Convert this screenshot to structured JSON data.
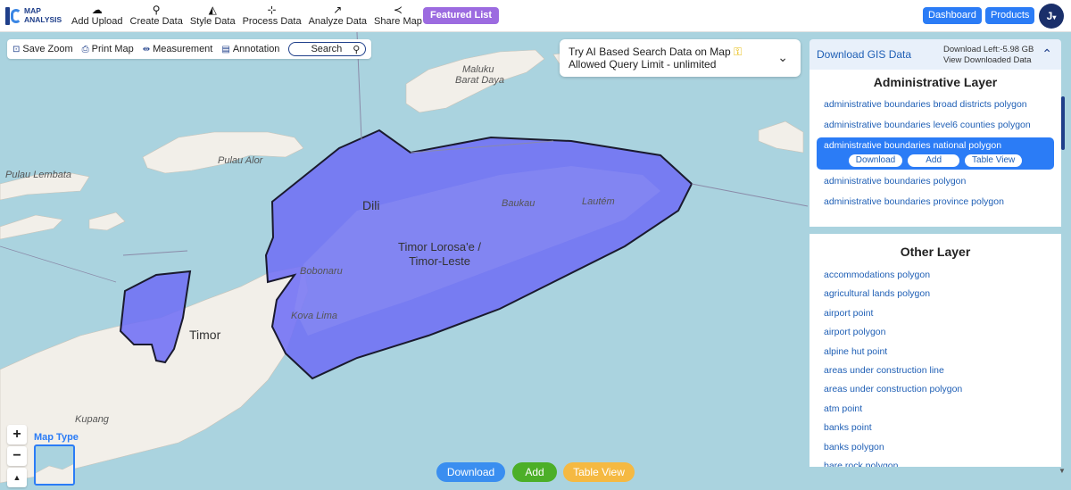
{
  "app": {
    "logo_line1": "MAP",
    "logo_line2": "ANALYSIS"
  },
  "toolbar": {
    "items": [
      {
        "label": "Add Upload",
        "icon": "cloud-upload-icon"
      },
      {
        "label": "Create Data",
        "icon": "map-pin-icon"
      },
      {
        "label": "Style Data",
        "icon": "paint-bucket-icon"
      },
      {
        "label": "Process Data",
        "icon": "process-icon"
      },
      {
        "label": "Analyze Data",
        "icon": "analyze-icon"
      },
      {
        "label": "Share Map",
        "icon": "share-icon"
      }
    ],
    "featured": "Featured List",
    "dashboard": "Dashboard",
    "products": "Products",
    "avatar": "J"
  },
  "map_tools": {
    "save_zoom": "Save Zoom",
    "print_map": "Print Map",
    "measurement": "Measurement",
    "annotation": "Annotation",
    "search": "Search"
  },
  "ai_box": {
    "line1": "Try AI Based Search Data on Map",
    "line2": "Allowed Query Limit - unlimited"
  },
  "places": {
    "maluku": "Maluku",
    "barat_daya": "Barat Daya",
    "pulau_alor": "Pulau Alor",
    "pulau_lembata": "Pulau Lembata",
    "dili": "Dili",
    "baukau": "Baukau",
    "lautem": "Lautém",
    "country1": "Timor Lorosa'e /",
    "country2": "Timor-Leste",
    "bobonaru": "Bobonaru",
    "kova_lima": "Kova Lima",
    "timor": "Timor",
    "kupang": "Kupang"
  },
  "panel": {
    "title": "Download GIS Data",
    "download_left": "Download Left:-5.98 GB",
    "view_downloaded": "View Downloaded Data",
    "admin_title": "Administrative Layer",
    "admin_layers": [
      "administrative boundaries broad districts polygon",
      "administrative boundaries level6 counties polygon",
      "administrative boundaries national polygon",
      "administrative boundaries polygon",
      "administrative boundaries province polygon"
    ],
    "selected_buttons": [
      "Download",
      "Add",
      "Table View"
    ],
    "other_title": "Other Layer",
    "other_layers": [
      "accommodations polygon",
      "agricultural lands polygon",
      "airport point",
      "airport polygon",
      "alpine hut point",
      "areas under construction line",
      "areas under construction polygon",
      "atm point",
      "banks point",
      "banks polygon",
      "bare rock polygon"
    ]
  },
  "map_controls": {
    "zoom_in": "+",
    "zoom_out": "−",
    "reset": "▲",
    "map_type": "Map Type"
  },
  "bottom": {
    "download": "Download",
    "add": "Add",
    "table_view": "Table View"
  },
  "colors": {
    "sea": "#aad3df",
    "land": "#f2efe9",
    "selection": "#6f6ff5",
    "accent": "#2b7cf6"
  }
}
